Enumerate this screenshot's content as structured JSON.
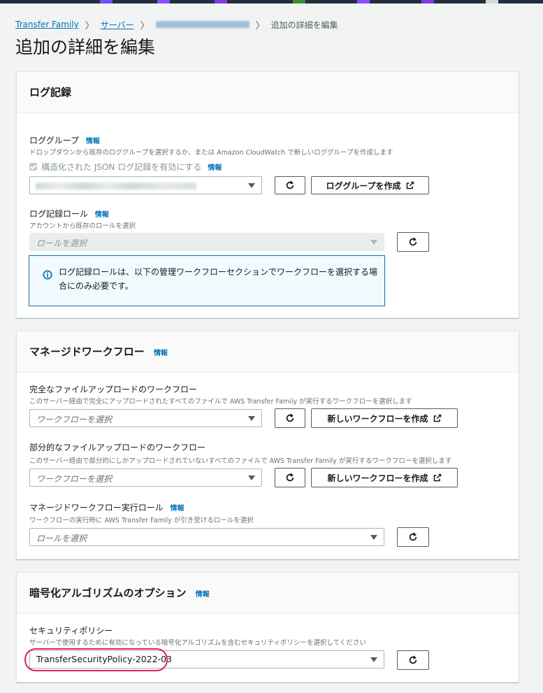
{
  "breadcrumb": {
    "items": [
      "Transfer Family",
      "サーバー",
      "s-b1ce4f6e9f8a4c2d9"
    ],
    "current": "追加の詳細を編集"
  },
  "page": {
    "title": "追加の詳細を編集"
  },
  "logging": {
    "title": "ログ記録",
    "log_group": {
      "label": "ロググループ",
      "info": "情報",
      "description": "ドロップダウンから既存のロググループを選択するか、または Amazon CloudWatch で新しいロググループを作成します",
      "checkbox_label": "構造化された JSON ログ記録を有効にする",
      "checkbox_info": "情報",
      "create_button": "ロググループを作成"
    },
    "role": {
      "label": "ログ記録ロール",
      "info": "情報",
      "description": "アカウントから既存のロールを選択",
      "placeholder": "ロールを選択"
    },
    "alert_text": "ログ記録ロールは、以下の管理ワークフローセクションでワークフローを選択する場合にのみ必要です。"
  },
  "workflows": {
    "title": "マネージドワークフロー",
    "info": "情報",
    "complete": {
      "label": "完全なファイルアップロードのワークフロー",
      "description": "このサーバー経由で完全にアップロードされたすべてのファイルで AWS Transfer Family が実行するワークフローを選択します",
      "placeholder": "ワークフローを選択",
      "create_button": "新しいワークフローを作成"
    },
    "partial": {
      "label": "部分的なファイルアップロードのワークフロー",
      "description": "このサーバー経由で部分的にしかアップロードされていないすべてのファイルで AWS Transfer Family が実行するワークフローを選択します",
      "placeholder": "ワークフローを選択",
      "create_button": "新しいワークフローを作成"
    },
    "role": {
      "label": "マネージドワークフロー実行ロール",
      "info": "情報",
      "description": "ワークフローの実行時に AWS Transfer Family が引き受けるロールを選択",
      "placeholder": "ロールを選択"
    }
  },
  "encryption": {
    "title": "暗号化アルゴリズムのオプション",
    "info": "情報",
    "policy": {
      "label": "セキュリティポリシー",
      "description": "サーバーで使用するために有効になっている暗号化アルゴリズムを含むセキュリティポリシーを選択してください",
      "value": "TransferSecurityPolicy-2022-03"
    }
  },
  "icons": {
    "refresh": "refresh-icon",
    "external": "external-link-icon",
    "caret": "caret-down-icon",
    "info": "info-circle-icon",
    "breadcrumb_sep": "chevron-right-icon"
  },
  "colors": {
    "link": "#0073bb",
    "highlight": "#e0205a",
    "alert_border": "#0073bb",
    "alert_bg": "#f1faff"
  }
}
